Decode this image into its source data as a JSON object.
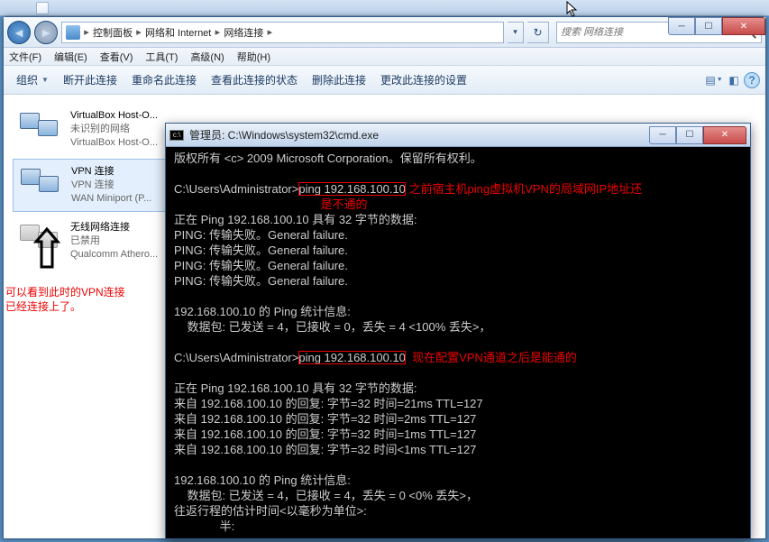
{
  "taskbar": {
    "title": ""
  },
  "explorer": {
    "breadcrumb": [
      "控制面板",
      "网络和 Internet",
      "网络连接"
    ],
    "search_placeholder": "搜索 网络连接",
    "menu": [
      "文件(F)",
      "编辑(E)",
      "查看(V)",
      "工具(T)",
      "高级(N)",
      "帮助(H)"
    ],
    "toolbar": [
      "组织",
      "断开此连接",
      "重命名此连接",
      "查看此连接的状态",
      "删除此连接",
      "更改此连接的设置"
    ],
    "connections": [
      {
        "name": "VirtualBox Host-O...",
        "status": "未识别的网络",
        "device": "VirtualBox Host-O..."
      },
      {
        "name": "VPN 连接",
        "status": "VPN 连接",
        "device": "WAN Miniport (P..."
      },
      {
        "name": "无线网络连接",
        "status": "已禁用",
        "device": "Qualcomm Athero..."
      }
    ]
  },
  "annot": {
    "left_line1": "可以看到此时的VPN连接",
    "left_line2": "已经连接上了。",
    "cmd1a": "之前宿主机ping虚拟机VPN的局域网IP地址还",
    "cmd1b": "是不通的",
    "cmd2": "现在配置VPN通道之后是能通的"
  },
  "cmd": {
    "title": "管理员: C:\\Windows\\system32\\cmd.exe",
    "l_copyright": "版权所有 <c> 2009 Microsoft Corporation。保留所有权利。",
    "prompt": "C:\\Users\\Administrator>",
    "ping_cmd": "ping 192.168.100.10",
    "l2": "正在 Ping 192.168.100.10 具有 32 字节的数据:",
    "fail": "PING: 传输失败。General failure.",
    "stat_h": "192.168.100.10 的 Ping 统计信息:",
    "stat1": "    数据包: 已发送 = 4，已接收 = 0，丢失 = 4 <100% 丢失>，",
    "r1": "来自 192.168.100.10 的回复: 字节=32 时间=21ms TTL=127",
    "r2": "来自 192.168.100.10 的回复: 字节=32 时间=2ms TTL=127",
    "r3": "来自 192.168.100.10 的回复: 字节=32 时间=1ms TTL=127",
    "r4": "来自 192.168.100.10 的回复: 字节=32 时间<1ms TTL=127",
    "stat2": "    数据包: 已发送 = 4，已接收 = 4，丢失 = 0 <0% 丢失>，",
    "rtt1": "往返行程的估计时间<以毫秒为单位>:",
    "rtt2": "              半:"
  }
}
